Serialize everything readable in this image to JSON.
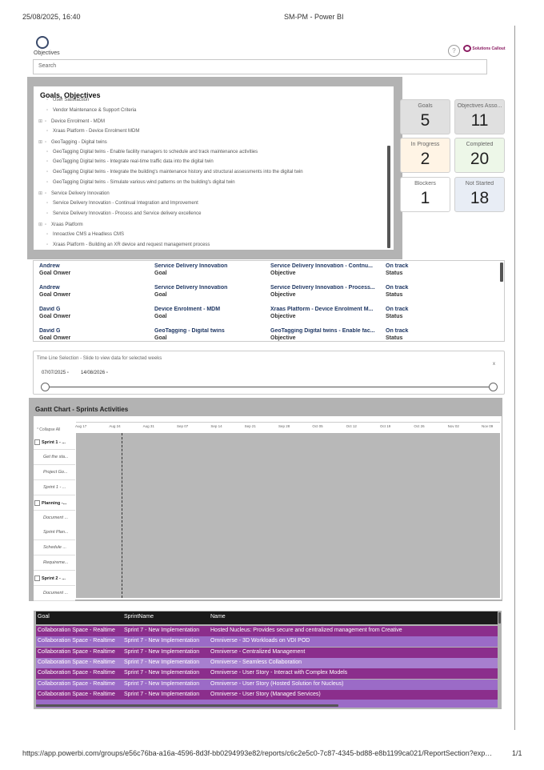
{
  "print": {
    "datetime": "25/08/2025, 16:40",
    "window_title": "SM-PM - Power BI",
    "url": "https://app.powerbi.com/groups/e56c76ba-a16a-4596-8d3f-bb0294993e82/reports/c6c2e5c0-7c87-4345-bd88-e8b1199ca021/ReportSection?exp…",
    "page": "1/1"
  },
  "header": {
    "objectives_label": "Objectives",
    "help_icon": "question-mark-icon",
    "brand_text": "Solutions Callout"
  },
  "search": {
    "placeholder": "Search"
  },
  "tree": {
    "title": "Goals, Objectives",
    "rows": [
      {
        "level": 2,
        "text": "User Satisfaction"
      },
      {
        "level": 2,
        "text": "Vendor Maintenance & Support Criteria"
      },
      {
        "level": 1,
        "text": "Device Enrolment - MDM"
      },
      {
        "level": 2,
        "text": "Xraas Platform - Device Enrolment MDM"
      },
      {
        "level": 1,
        "text": "GeoTagging - Digital twins"
      },
      {
        "level": 2,
        "text": "GeoTagging Digital twins - Enable facility managers to schedule and track maintenance activities"
      },
      {
        "level": 2,
        "text": "GeoTagging Digital twins - Integrate real-time traffic data into the digital twin"
      },
      {
        "level": 2,
        "text": "GeoTagging Digital twins - Integrate the building's maintenance history and structural assessments into the digital twin"
      },
      {
        "level": 2,
        "text": "GeoTagging Digital twins - Simulate various wind patterns on the building's digital twin"
      },
      {
        "level": 1,
        "text": "Service Delivery Innovation"
      },
      {
        "level": 2,
        "text": "Service Delivery Innovation - Continual Integration and Improvement"
      },
      {
        "level": 2,
        "text": "Service Delivery Innovation - Process and Service delivery excellence"
      },
      {
        "level": 1,
        "text": "Xraas Platform"
      },
      {
        "level": 2,
        "text": "Innoactive CMS a Headless CMS"
      },
      {
        "level": 2,
        "text": "Xraas Platform - Building an XR device and request management process"
      }
    ]
  },
  "cards": [
    {
      "label": "Goals",
      "value": "5",
      "bg": "#e0e0e0"
    },
    {
      "label": "Objectives Asso...",
      "value": "11",
      "bg": "#e0e0e0"
    },
    {
      "label": "In Progress",
      "value": "2",
      "bg": "#fff4e5"
    },
    {
      "label": "Completed",
      "value": "20",
      "bg": "#edf7e8"
    },
    {
      "label": "Blockers",
      "value": "1",
      "bg": "#ffffff"
    },
    {
      "label": "Not Started",
      "value": "18",
      "bg": "#e8edf5"
    }
  ],
  "records": [
    {
      "owner": "Andrew",
      "owner_label": "Goal Onwer",
      "goal": "Service Delivery Innovation",
      "goal_label": "Goal",
      "objective": "Service Delivery Innovation - Contnu...",
      "objective_label": "Objective",
      "status": "On track",
      "status_label": "Status"
    },
    {
      "owner": "Andrew",
      "owner_label": "Goal Onwer",
      "goal": "Service Delivery Innovation",
      "goal_label": "Goal",
      "objective": "Service Delivery Innovation - Process...",
      "objective_label": "Objective",
      "status": "On track",
      "status_label": "Status"
    },
    {
      "owner": "David G",
      "owner_label": "Goal Onwer",
      "goal": "Device Enrolment - MDM",
      "goal_label": "Goal",
      "objective": "Xraas Platform - Device Enrolment M...",
      "objective_label": "Objective",
      "status": "On track",
      "status_label": "Status"
    },
    {
      "owner": "David G",
      "owner_label": "Goal Onwer",
      "goal": "GeoTagging - Digital twins",
      "goal_label": "Goal",
      "objective": "GeoTagging Digital twins - Enable fac...",
      "objective_label": "Objective",
      "status": "On track",
      "status_label": "Status"
    }
  ],
  "slicer": {
    "title": "Time Line Selection - Slide to view data for selected weeks",
    "start": "07/07/2025",
    "end": "14/08/2026",
    "close": "x"
  },
  "gantt": {
    "title": "Gantt Chart - Sprints Activities",
    "collapse_label": "Collapse All",
    "ticks": [
      "Aug 17",
      "Aug 24",
      "Aug 31",
      "Sep 07",
      "Sep 14",
      "Sep 21",
      "Sep 28",
      "Oct 05",
      "Oct 12",
      "Oct 19",
      "Oct 26",
      "Nov 02",
      "Nov 09"
    ],
    "tasks": [
      {
        "text": "Sprint 1 - ...",
        "kind": "grp"
      },
      {
        "text": "Get the sta...",
        "kind": "sub"
      },
      {
        "text": "Project Go...",
        "kind": "sub"
      },
      {
        "text": "Sprint 1 - ...",
        "kind": "sub"
      },
      {
        "text": "Planning -...",
        "kind": "grp"
      },
      {
        "text": "Document ...",
        "kind": "sub"
      },
      {
        "text": "Sprint Plan...",
        "kind": "sub"
      },
      {
        "text": "Schedule ...",
        "kind": "sub"
      },
      {
        "text": "Requireme...",
        "kind": "sub"
      },
      {
        "text": "Sprint 2 - ...",
        "kind": "grp"
      },
      {
        "text": "Document ...",
        "kind": "sub"
      }
    ]
  },
  "matrix": {
    "headers": [
      "Goal",
      "SprintName",
      "Name"
    ],
    "rows": [
      {
        "goal": "Collaboration Space - Realtime",
        "sprint": "Sprint 7 - New Implementation",
        "name": "Hosted Nucleus: Provides secure and centralized management from Creative",
        "bg": "#8b2e8c"
      },
      {
        "goal": "Collaboration Space - Realtime",
        "sprint": "Sprint 7 - New Implementation",
        "name": "Omniverse - 3D Workloads on VDI POD",
        "bg": "#9b6bc7"
      },
      {
        "goal": "Collaboration Space - Realtime",
        "sprint": "Sprint 7 - New Implementation",
        "name": "Omniverse - Centralized Management",
        "bg": "#8b2e8c"
      },
      {
        "goal": "Collaboration Space - Realtime",
        "sprint": "Sprint 7 - New Implementation",
        "name": "Omniverse - Seamless Collaboration",
        "bg": "#a77fcf"
      },
      {
        "goal": "Collaboration Space - Realtime",
        "sprint": "Sprint 7 - New Implementation",
        "name": "Omniverse - User Story - Interact with Complex Models",
        "bg": "#8b2e8c"
      },
      {
        "goal": "Collaboration Space - Realtime",
        "sprint": "Sprint 7 - New Implementation",
        "name": "Omniverse - User Story (Hosted Solution for Nucleus)",
        "bg": "#9b6bc7"
      },
      {
        "goal": "Collaboration Space - Realtime",
        "sprint": "Sprint 7 - New Implementation",
        "name": "Omniverse - User Story (Managed Services)",
        "bg": "#8b2e8c"
      }
    ]
  }
}
